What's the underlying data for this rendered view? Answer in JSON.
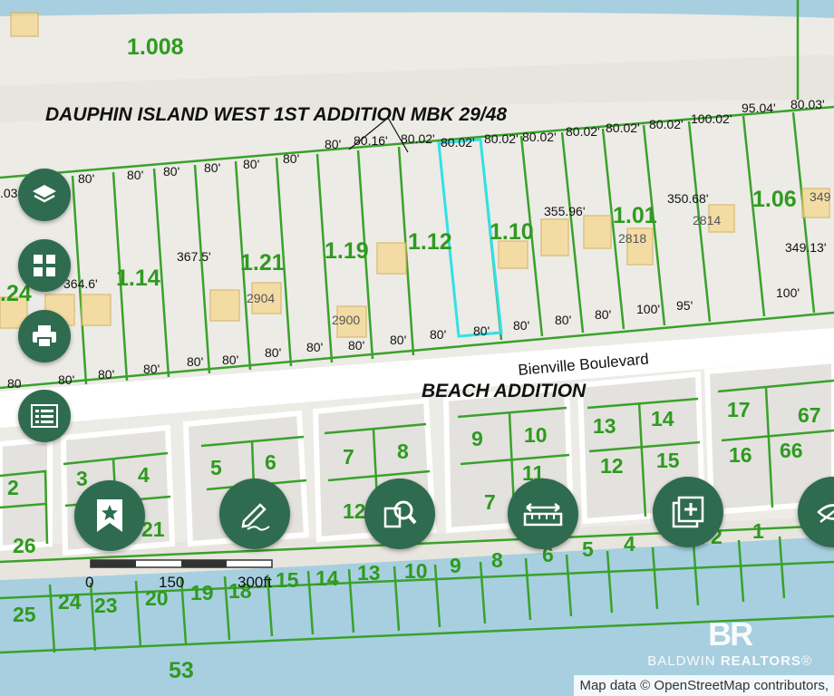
{
  "map": {
    "subdivision_label": "DAUPHIN ISLAND WEST 1ST ADDITION MBK 29/48",
    "beach_addition_label": "BEACH ADDITION",
    "street_label": "Bienville Boulevard",
    "block_labels": [
      "1.008",
      "1.14",
      "1.21",
      "1.19",
      "1.12",
      "1.10",
      "1.01",
      "1.06",
      ".24"
    ],
    "dimension_labels": [
      ".03",
      "80'",
      "80'",
      "80'",
      "80'",
      "80'",
      "80'",
      "80'",
      "80.16'",
      "80.02'",
      "80.02'",
      "80.02'",
      "80.02'",
      "80.02'",
      "80.02'",
      "80.02'",
      "100.02'",
      "95.04'",
      "80.03'",
      "367.5'",
      "364.6'",
      "355.96'",
      "350.68'",
      "349.13'",
      "80'",
      "80'",
      "80'",
      "80'",
      "80'",
      "80'",
      "80'",
      "80'",
      "80'",
      "80'",
      "80'",
      "80'",
      "80'",
      "80'",
      "100'",
      "95'",
      "80",
      "100'"
    ],
    "house_numbers": [
      "2904",
      "2900",
      "2818",
      "2814",
      "349"
    ],
    "lower_lot_numbers": [
      "2",
      "3",
      "4",
      "5",
      "6",
      "7",
      "8",
      "9",
      "10",
      "13",
      "14",
      "17",
      "67",
      "66",
      "16",
      "15",
      "12",
      "11",
      "7",
      "12",
      "26",
      "21",
      "25",
      "24",
      "23",
      "20",
      "19",
      "18",
      "15",
      "14",
      "13",
      "10",
      "9",
      "8",
      "6",
      "5",
      "4",
      "2",
      "1",
      "53"
    ],
    "selected_lot": "1.12"
  },
  "scale_bar": {
    "labels": [
      "0",
      "150",
      "300ft"
    ]
  },
  "controls": {
    "side": [
      "layers-button",
      "basemap-grid-button",
      "print-button",
      "legend-list-button"
    ],
    "bottom": [
      "bookmark-button",
      "draw-button",
      "identify-search-button",
      "measure-button",
      "add-data-button",
      "hide-button"
    ]
  },
  "attribution": "Map data © OpenStreetMap contributors,",
  "brand": {
    "logo": "BR",
    "name_light": "BALDWIN ",
    "name_bold": "REALTORS",
    "mark": "®"
  },
  "colors": {
    "parcel_line": "#3aa12b",
    "label_green": "#2f9a1f",
    "selected": "#33e0e6",
    "water": "#a7cfe0",
    "fab": "#2f6b4f"
  }
}
